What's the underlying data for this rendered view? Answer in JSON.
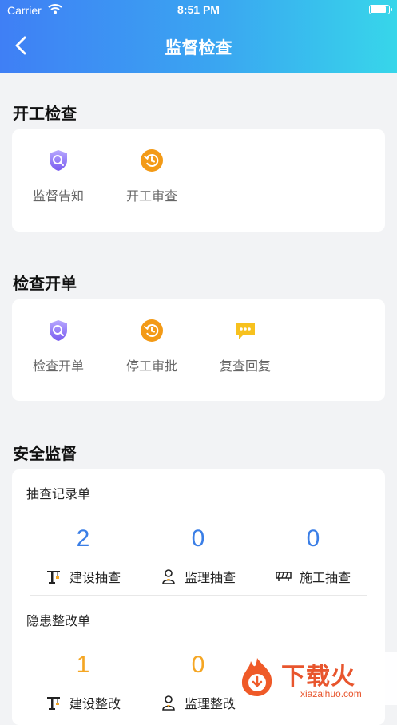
{
  "status_bar": {
    "carrier": "Carrier",
    "time": "8:51 PM"
  },
  "header": {
    "title": "监督检查"
  },
  "sections": {
    "start_check": {
      "title": "开工检查",
      "items": [
        {
          "label": "监督告知",
          "icon": "shield-search-icon"
        },
        {
          "label": "开工审查",
          "icon": "clock-refresh-icon"
        }
      ]
    },
    "check_order": {
      "title": "检查开单",
      "items": [
        {
          "label": "检查开单",
          "icon": "shield-search-icon"
        },
        {
          "label": "停工审批",
          "icon": "clock-refresh-icon"
        },
        {
          "label": "复查回复",
          "icon": "chat-bubble-icon"
        }
      ]
    },
    "safety": {
      "title": "安全监督",
      "spot_check": {
        "title": "抽查记录单",
        "stats": [
          {
            "value": "2",
            "label": "建设抽查",
            "color": "#3a7ee6",
            "icon": "crane-icon"
          },
          {
            "value": "0",
            "label": "监理抽查",
            "color": "#3a7ee6",
            "icon": "supervisor-icon"
          },
          {
            "value": "0",
            "label": "施工抽查",
            "color": "#3a7ee6",
            "icon": "barrier-icon"
          }
        ]
      },
      "rectify": {
        "title": "隐患整改单",
        "stats": [
          {
            "value": "1",
            "label": "建设整改",
            "color": "#f5a623",
            "icon": "crane-icon"
          },
          {
            "value": "0",
            "label": "监理整改",
            "color": "#f5a623",
            "icon": "supervisor-icon"
          }
        ]
      }
    }
  },
  "watermark": {
    "cn": "下载火",
    "en": "xiazaihuo.com"
  },
  "colors": {
    "header_start": "#3f7ff5",
    "header_end": "#37d6ea",
    "accent_blue": "#3a7ee6",
    "accent_orange": "#f5a623"
  }
}
